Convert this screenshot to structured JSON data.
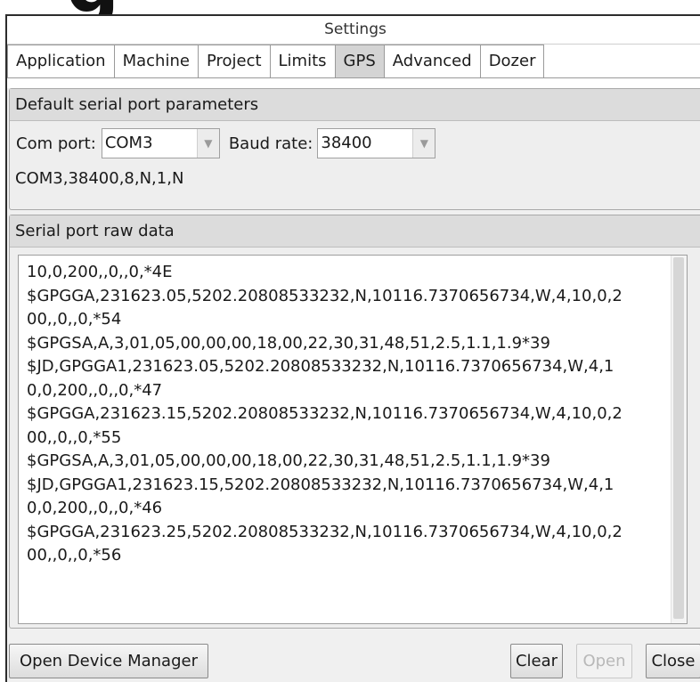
{
  "cropped_heading": "g",
  "window": {
    "title": "Settings"
  },
  "tabs": [
    {
      "label": "Application",
      "active": false
    },
    {
      "label": "Machine",
      "active": false
    },
    {
      "label": "Project",
      "active": false
    },
    {
      "label": "Limits",
      "active": false
    },
    {
      "label": "GPS",
      "active": true
    },
    {
      "label": "Advanced",
      "active": false
    },
    {
      "label": "Dozer",
      "active": false
    }
  ],
  "serial_params": {
    "header": "Default serial port parameters",
    "com_port_label": "Com port:",
    "com_port_value": "COM3",
    "baud_rate_label": "Baud rate:",
    "baud_rate_value": "38400",
    "summary": "COM3,38400,8,N,1,N"
  },
  "raw_data": {
    "header": "Serial port raw data",
    "lines": [
      "10,0,200,,0,,0,*4E",
      "$GPGGA,231623.05,5202.20808533232,N,10116.7370656734,W,4,10,0,2",
      "00,,0,,0,*54",
      "$GPGSA,A,3,01,05,00,00,00,18,00,22,30,31,48,51,2.5,1.1,1.9*39",
      "$JD,GPGGA1,231623.05,5202.20808533232,N,10116.7370656734,W,4,1",
      "0,0,200,,0,,0,*47",
      "$GPGGA,231623.15,5202.20808533232,N,10116.7370656734,W,4,10,0,2",
      "00,,0,,0,*55",
      "$GPGSA,A,3,01,05,00,00,00,18,00,22,30,31,48,51,2.5,1.1,1.9*39",
      "$JD,GPGGA1,231623.15,5202.20808533232,N,10116.7370656734,W,4,1",
      "0,0,200,,0,,0,*46",
      "$GPGGA,231623.25,5202.20808533232,N,10116.7370656734,W,4,10,0,2",
      "00,,0,,0,*56"
    ]
  },
  "buttons": {
    "open_device_manager": "Open Device Manager",
    "clear": "Clear",
    "open": "Open",
    "close": "Close"
  }
}
